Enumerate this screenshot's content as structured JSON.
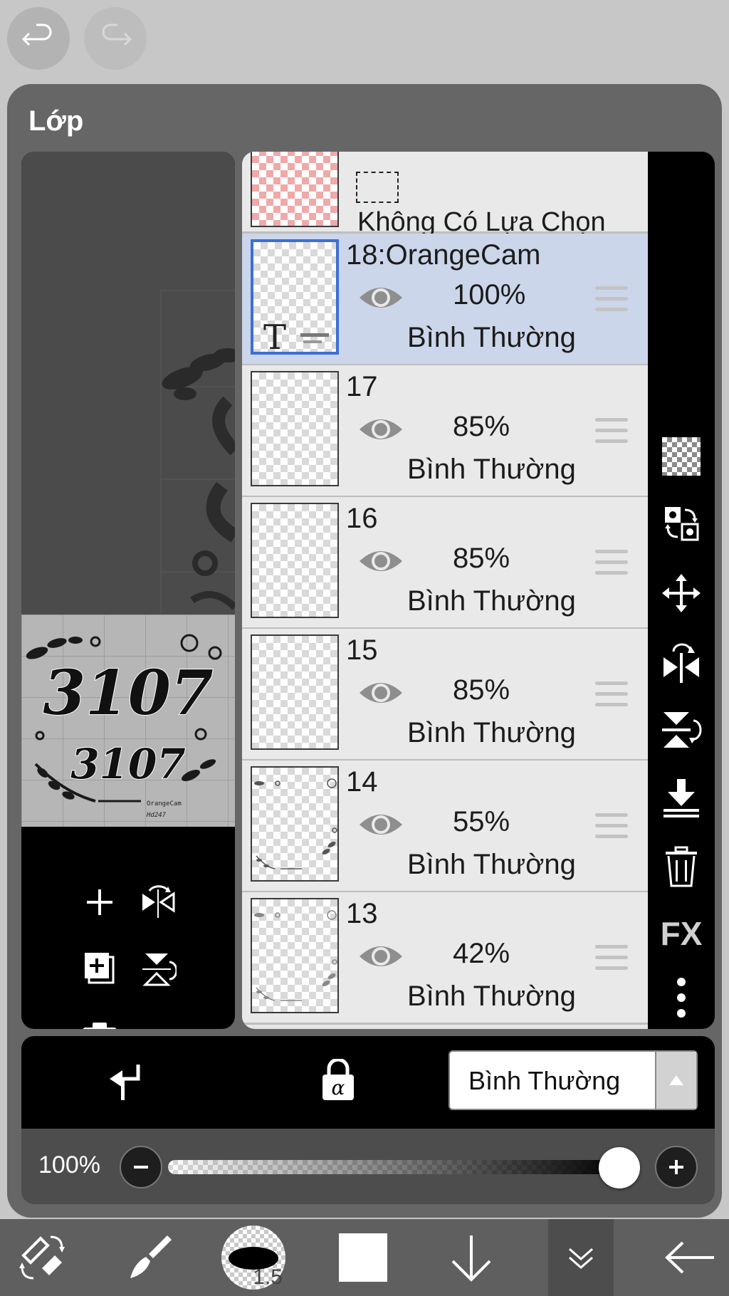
{
  "panel": {
    "title": "Lớp",
    "selection_label": "Không Có Lựa Chọn"
  },
  "layers": [
    {
      "name": "18:OrangeCam",
      "opacity": "100%",
      "blend": "Bình Thường",
      "selected": true,
      "thumb_text": "T"
    },
    {
      "name": "17",
      "opacity": "85%",
      "blend": "Bình Thường",
      "selected": false
    },
    {
      "name": "16",
      "opacity": "85%",
      "blend": "Bình Thường",
      "selected": false
    },
    {
      "name": "15",
      "opacity": "85%",
      "blend": "Bình Thường",
      "selected": false
    },
    {
      "name": "14",
      "opacity": "55%",
      "blend": "Bình Thường",
      "selected": false
    },
    {
      "name": "13",
      "opacity": "42%",
      "blend": "Bình Thường",
      "selected": false
    }
  ],
  "preview": {
    "artwork_text_large": "3107",
    "artwork_text_small": "3107",
    "signature_line1": "OrangeCam",
    "signature_line2": "Hd247"
  },
  "right_tools": {
    "fx_label": "FX"
  },
  "bottom": {
    "blend_mode": "Bình Thường"
  },
  "opacity": {
    "label": "100%",
    "value": 1.0
  },
  "toolbar": {
    "brush_size": "1.5"
  },
  "icons": {
    "undo": "undo-icon",
    "redo": "redo-icon",
    "eye": "eye-icon",
    "handle": "drag-handle-icon",
    "checker": "transparency-icon",
    "swap": "swap-icon",
    "move": "move-icon",
    "flip_h": "flip-horizontal-icon",
    "flip_v": "flip-vertical-icon",
    "merge_down": "merge-down-icon",
    "trash": "trash-icon",
    "more": "more-icon",
    "plus": "plus-icon",
    "add_layer": "add-layer-icon",
    "camera": "camera-icon",
    "clip": "clipping-icon",
    "alpha_lock": "alpha-lock-icon"
  },
  "colors": {
    "accent": "#3d6fd4",
    "selected_row": "#ccd6ea",
    "panel": "#666666",
    "selection_thumb": "#f0a9a9"
  }
}
